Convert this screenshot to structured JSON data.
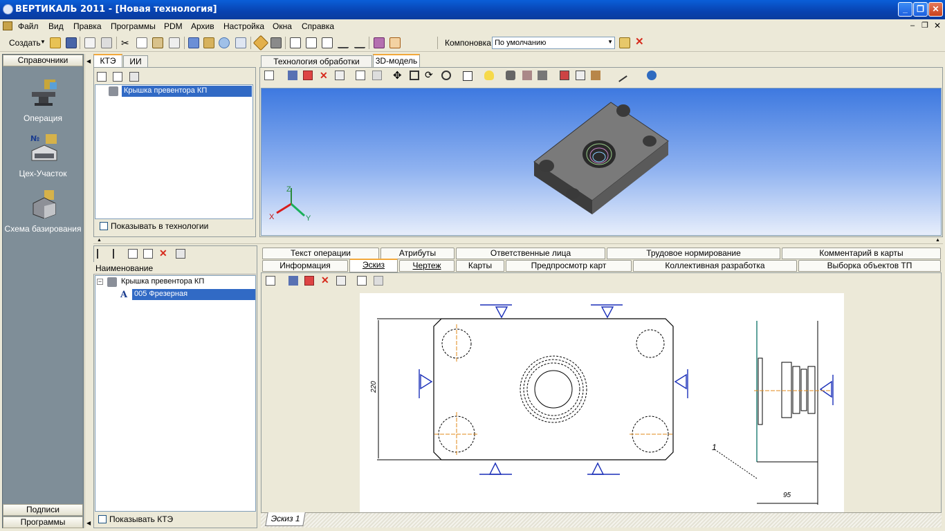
{
  "window": {
    "title": "ВЕРТИКАЛЬ 2011 - [Новая технология]"
  },
  "menu": [
    "Файл",
    "Вид",
    "Правка",
    "Программы",
    "PDM",
    "Архив",
    "Настройка",
    "Окна",
    "Справка"
  ],
  "toolbar": {
    "create_label": "Создать",
    "layout_label": "Компоновка",
    "layout_value": "По умолчанию"
  },
  "leftnav": {
    "header": "Справочники",
    "items": [
      {
        "label": "Операция",
        "icon": "anvil-icon"
      },
      {
        "label": "Цех-Участок",
        "icon": "workshop-icon"
      },
      {
        "label": "Схема базирования",
        "icon": "fixture-icon"
      }
    ],
    "footer": [
      "Подписи",
      "Программы"
    ]
  },
  "kte_panel": {
    "tabs": [
      "КТЭ",
      "ИИ"
    ],
    "tree_item": "Крышка превентора КП",
    "checkbox_label": "Показывать в технологии"
  },
  "view_tabs": [
    "Технология обработки детали",
    "3D-модель"
  ],
  "axes": {
    "x": "X",
    "y": "Y",
    "z": "Z"
  },
  "tech_tree": {
    "column": "Наименование",
    "items": [
      "Крышка превентора КП",
      "005 Фрезерная"
    ],
    "checkbox_label": "Показывать КТЭ"
  },
  "op_tabs_row1": [
    "Текст операции",
    "Атрибуты",
    "Ответственные лица",
    "Трудовое нормирование",
    "Комментарий в карты"
  ],
  "op_tabs_row2": [
    "Информация",
    "Эскиз",
    "Чертеж",
    "Карты",
    "Предпросмотр карт",
    "Коллективная разработка",
    "Выборка объектов ТП"
  ],
  "drawing": {
    "dim_vertical": "220",
    "dim_horizontal": "95",
    "leader_label": "1"
  },
  "sketch_tab": "Эскиз 1",
  "colors": {
    "title_bar": "#0a4bc0",
    "nav_bg": "#7f8e98",
    "selection": "#316ac5",
    "tab_accent": "#f2a83a"
  }
}
